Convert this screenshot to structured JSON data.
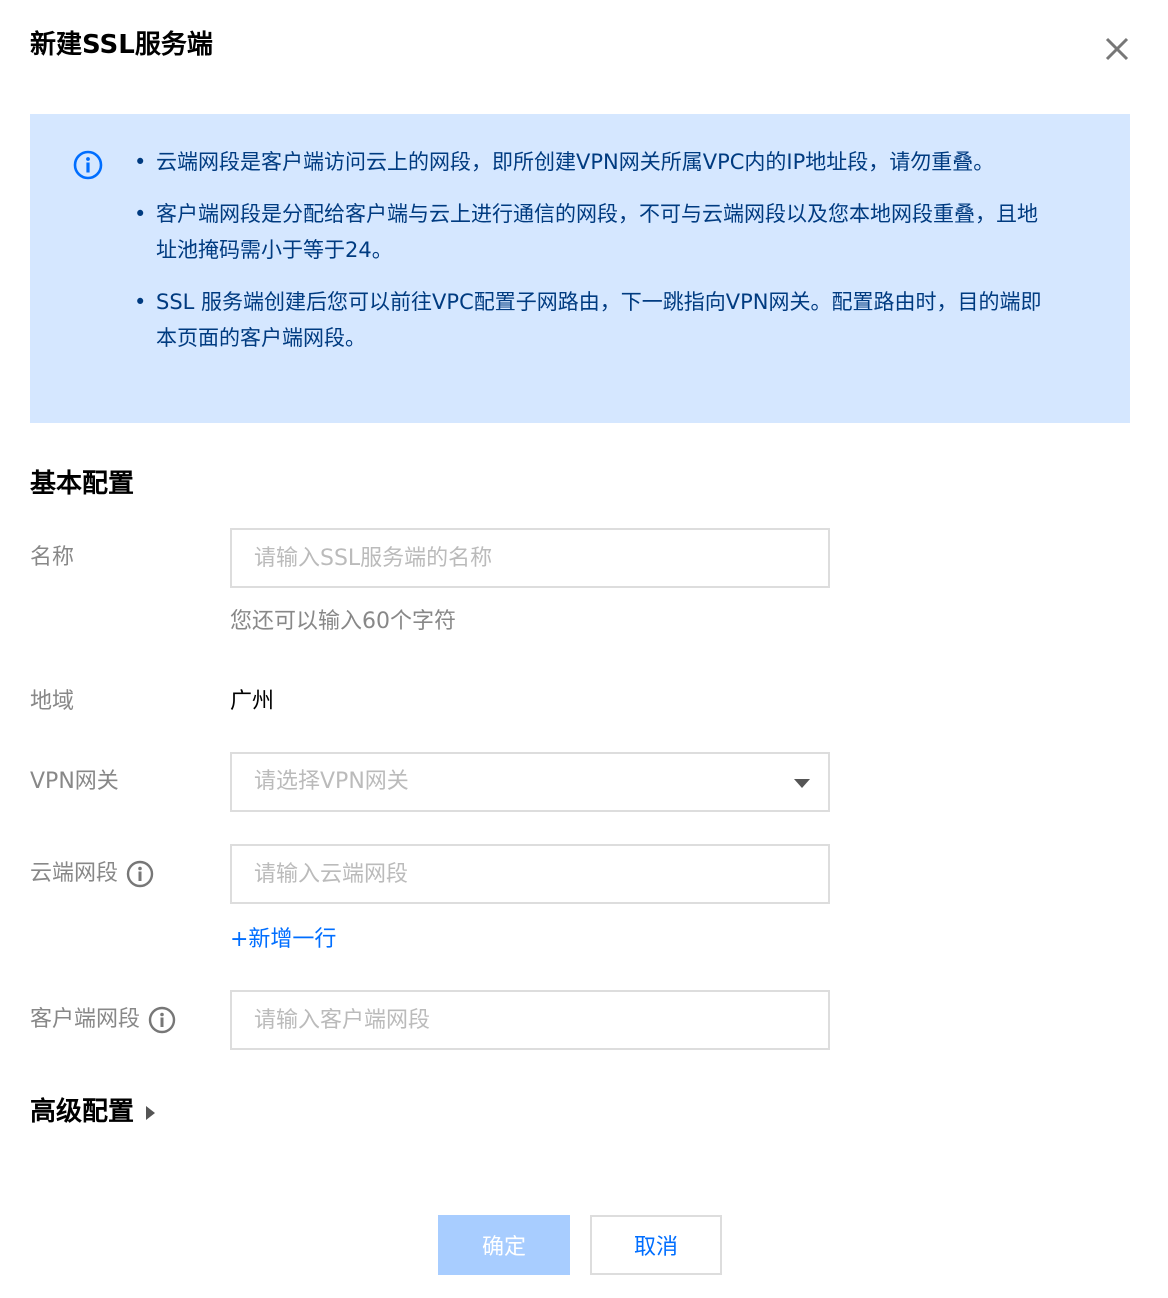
{
  "dialog": {
    "title": "新建SSL服务端",
    "close_icon": "close-icon"
  },
  "notice": {
    "icon": "info-icon",
    "items": [
      {
        "text": "云端网段是客户端访问云上的网段，即所创建VPN网关所属VPC内的IP地址段，请勿重叠。"
      },
      {
        "text": "客户端网段是分配给客户端与云上进行通信的网段，不可与云端网段以及您本地网段重叠，且地址池掩码需小于等于24。"
      },
      {
        "text": "SSL 服务端创建后您可以前往VPC配置子网路由，下一跳指向VPN网关。配置路由时，目的端即本页面的客户端网段。"
      }
    ]
  },
  "basic": {
    "title": "基本配置",
    "name": {
      "label": "名称",
      "value": "",
      "placeholder": "请输入SSL服务端的名称",
      "hint": "您还可以输入60个字符"
    },
    "region": {
      "label": "地域",
      "value": "广州"
    },
    "gateway": {
      "label": "VPN网关",
      "placeholder": "请选择VPN网关"
    },
    "cloud_cidr": {
      "label": "云端网段",
      "value": "",
      "placeholder": "请输入云端网段",
      "add_row": "+新增一行"
    },
    "client_cidr": {
      "label": "客户端网段",
      "value": "",
      "placeholder": "请输入客户端网段"
    }
  },
  "advanced": {
    "title": "高级配置"
  },
  "footer": {
    "confirm_label": "确定",
    "cancel_label": "取消"
  },
  "colors": {
    "accent": "#006eff",
    "notice_bg": "#d5e7ff",
    "notice_text": "#003b80",
    "confirm_disabled": "#a8cdff"
  }
}
